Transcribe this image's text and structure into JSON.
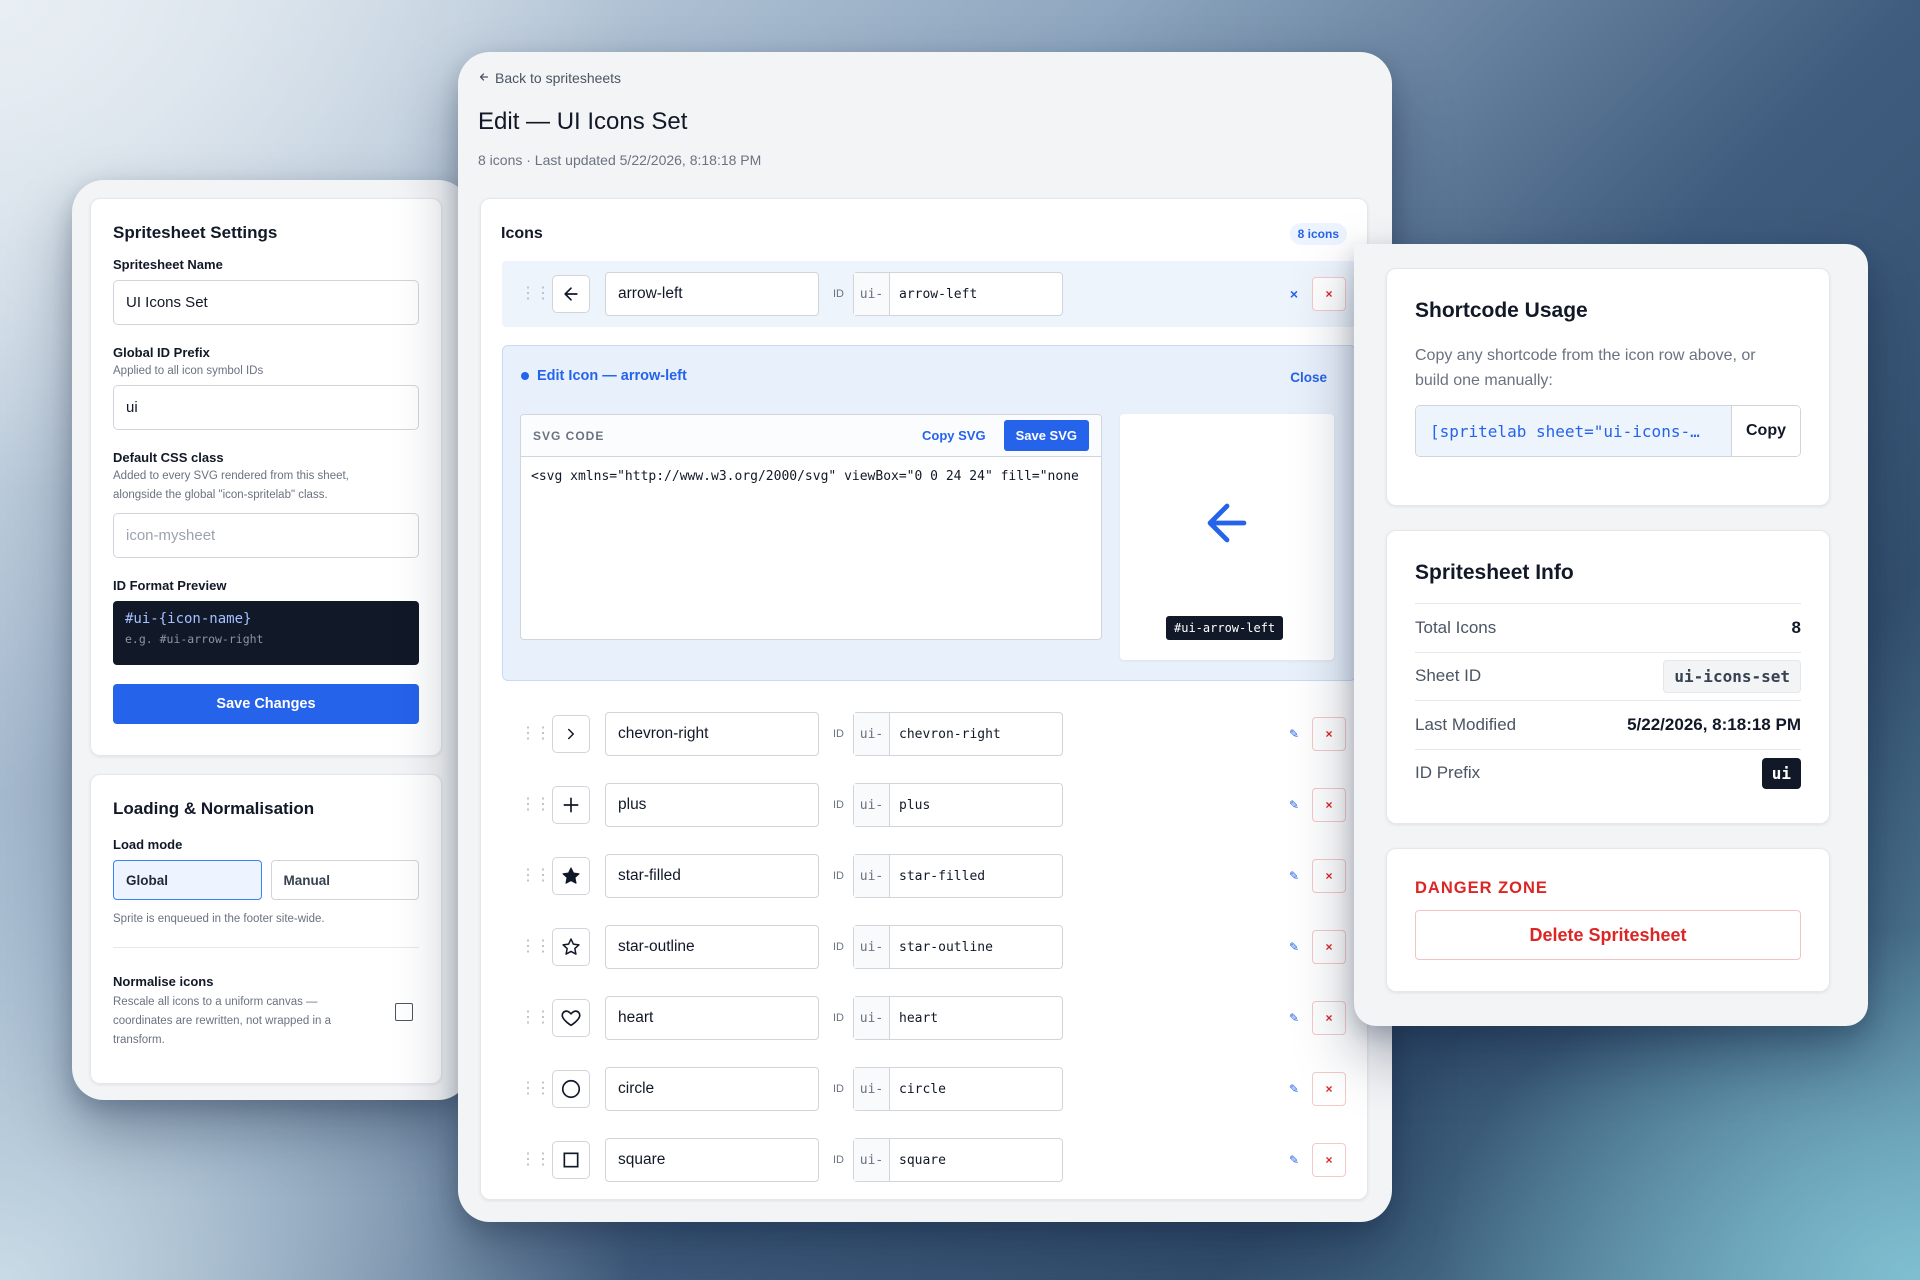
{
  "settings": {
    "title": "Spritesheet Settings",
    "name_label": "Spritesheet Name",
    "name_value": "UI Icons Set",
    "prefix_label": "Global ID Prefix",
    "prefix_help": "Applied to all icon symbol IDs",
    "prefix_value": "ui",
    "css_label": "Default CSS class",
    "css_help_1": "Added to every SVG rendered from this sheet,",
    "css_help_2": "alongside the global \"icon-spritelab\" class.",
    "css_placeholder": "icon-mysheet",
    "preview_label": "ID Format Preview",
    "preview_format": "#ui-{icon-name}",
    "preview_example": "e.g. #ui-arrow-right",
    "save_label": "Save Changes"
  },
  "loading": {
    "title": "Loading & Normalisation",
    "load_mode_label": "Load mode",
    "options": [
      "Global",
      "Manual"
    ],
    "selected": "Global",
    "load_help": "Sprite is enqueued in the footer site-wide.",
    "normalise_label": "Normalise icons",
    "normalise_help_1": "Rescale all icons to a uniform canvas —",
    "normalise_help_2": "coordinates are rewritten, not wrapped in a",
    "normalise_help_3": "transform.",
    "normalise_checked": false
  },
  "header": {
    "back_label": "Back to spritesheets",
    "title": "Edit — UI Icons Set",
    "subtitle": "8 icons · Last updated 5/22/2026, 8:18:18 PM"
  },
  "icons_panel": {
    "heading": "Icons",
    "count_badge": "8 icons",
    "id_label": "ID",
    "id_prefix": "ui-",
    "rows": [
      {
        "icon": "arrow-left-icon",
        "name": "arrow-left",
        "id": "arrow-left"
      },
      {
        "icon": "chevron-right-icon",
        "name": "chevron-right",
        "id": "chevron-right"
      },
      {
        "icon": "plus-icon",
        "name": "plus",
        "id": "plus"
      },
      {
        "icon": "star-filled-icon",
        "name": "star-filled",
        "id": "star-filled"
      },
      {
        "icon": "star-outline-icon",
        "name": "star-outline",
        "id": "star-outline"
      },
      {
        "icon": "heart-icon",
        "name": "heart",
        "id": "heart"
      },
      {
        "icon": "circle-icon",
        "name": "circle",
        "id": "circle"
      },
      {
        "icon": "square-icon",
        "name": "square",
        "id": "square"
      }
    ],
    "collapse_glyph": "×",
    "edit_glyph": "✎",
    "delete_glyph": "×"
  },
  "editor": {
    "title": "Edit Icon — arrow-left",
    "close_label": "Close",
    "code_label": "SVG CODE",
    "copy_label": "Copy SVG",
    "save_label": "Save SVG",
    "code": "<svg xmlns=\"http://www.w3.org/2000/svg\" viewBox=\"0 0 24 24\" fill=\"none",
    "preview_chip": "#ui-arrow-left"
  },
  "shortcode": {
    "title": "Shortcode Usage",
    "desc_1": "Copy any shortcode from the icon row above, or",
    "desc_2": "build one manually:",
    "value": "[spritelab sheet=\"ui-icons-…",
    "copy_label": "Copy"
  },
  "info": {
    "title": "Spritesheet Info",
    "total_label": "Total Icons",
    "total_value": "8",
    "sheet_id_label": "Sheet ID",
    "sheet_id_value": "ui-icons-set",
    "modified_label": "Last Modified",
    "modified_value": "5/22/2026, 8:18:18 PM",
    "prefix_label": "ID Prefix",
    "prefix_value": "ui"
  },
  "danger": {
    "title": "DANGER ZONE",
    "delete_label": "Delete Spritesheet"
  },
  "colors": {
    "accent": "#2563eb",
    "danger": "#dc2626",
    "dark": "#111827"
  }
}
